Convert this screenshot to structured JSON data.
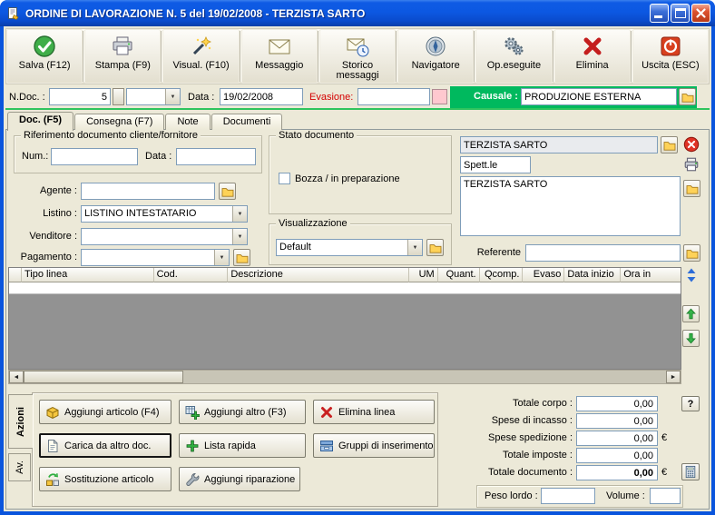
{
  "window": {
    "title": "ORDINE DI LAVORAZIONE N. 5  del 19/02/2008 - TERZISTA SARTO"
  },
  "colors": {
    "titlebar_blue": "#0a55dd",
    "causale_green": "#00b95e",
    "evasione_pink": "#ffc8cf",
    "grid_body_gray": "#929292"
  },
  "icons": {
    "combo_arrow": "▼",
    "scroll_left": "◄",
    "scroll_right": "►"
  },
  "toolbar": {
    "buttons": [
      {
        "label": "Salva (F12)",
        "icon": "save-check-icon"
      },
      {
        "label": "Stampa (F9)",
        "icon": "printer-icon"
      },
      {
        "label": "Visual. (F10)",
        "icon": "magic-wand-icon"
      },
      {
        "label": "Messaggio",
        "icon": "envelope-icon"
      },
      {
        "label": "Storico messaggi",
        "icon": "envelope-history-icon"
      },
      {
        "label": "Navigatore",
        "icon": "compass-icon"
      },
      {
        "label": "Op.eseguite",
        "icon": "gears-icon"
      },
      {
        "label": "Elimina",
        "icon": "red-x-icon"
      },
      {
        "label": "Uscita (ESC)",
        "icon": "power-icon"
      }
    ]
  },
  "doc_header": {
    "ndoc_label": "N.Doc. :",
    "ndoc_value": "5",
    "serie_value": "",
    "data_label": "Data :",
    "data_value": "19/02/2008",
    "evasione_label": "Evasione:",
    "evasione_value": "",
    "causale_label": "Causale :",
    "causale_value": "PRODUZIONE ESTERNA"
  },
  "tabs": [
    {
      "label": "Doc. (F5)",
      "active": true
    },
    {
      "label": "Consegna (F7)",
      "active": false
    },
    {
      "label": "Note",
      "active": false
    },
    {
      "label": "Documenti",
      "active": false
    }
  ],
  "form": {
    "riferimento_group_label": "Riferimento documento cliente/fornitore",
    "num_label": "Num.:",
    "num_value": "",
    "rif_data_label": "Data :",
    "rif_data_value": "",
    "agente_label": "Agente :",
    "agente_value": "",
    "listino_label": "Listino :",
    "listino_value": "LISTINO INTESTATARIO",
    "venditore_label": "Venditore :",
    "venditore_value": "",
    "pagamento_label": "Pagamento :",
    "pagamento_value": "",
    "stato_group_label": "Stato documento",
    "bozza_checkbox_label": "Bozza / in preparazione",
    "bozza_checked": false,
    "visualizzazione_group_label": "Visualizzazione",
    "visualizzazione_value": "Default",
    "intestatario_value": "TERZISTA SARTO",
    "titolo_value": "Spett.le",
    "indirizzo_value": "TERZISTA SARTO",
    "referente_label": "Referente",
    "referente_value": ""
  },
  "grid": {
    "columns": [
      "",
      "Tipo linea",
      "Cod.",
      "Descrizione",
      "UM",
      "Quant.",
      "Qcomp.",
      "Evaso",
      "Data inizio",
      "Ora in"
    ]
  },
  "actions": {
    "tab_azioni_label": "Azioni",
    "tab_av_label": "Av.",
    "buttons": [
      {
        "label": "Aggiungi articolo (F4)",
        "icon": "package-icon"
      },
      {
        "label": "Aggiungi altro (F3)",
        "icon": "add-grid-icon"
      },
      {
        "label": "Elimina linea",
        "icon": "delete-line-icon"
      },
      {
        "label": "Carica da altro doc.",
        "icon": "load-document-icon"
      },
      {
        "label": "Lista rapida",
        "icon": "add-plus-icon"
      },
      {
        "label": "Gruppi di inserimento",
        "icon": "insert-group-icon"
      },
      {
        "label": "Sostituzione articolo",
        "icon": "swap-article-icon"
      },
      {
        "label": "Aggiungi riparazione",
        "icon": "wrench-icon"
      }
    ]
  },
  "totals": {
    "rows": [
      {
        "label": "Totale corpo :",
        "value": "0,00",
        "suffix": ""
      },
      {
        "label": "Spese di incasso :",
        "value": "0,00",
        "suffix": ""
      },
      {
        "label": "Spese spedizione :",
        "value": "0,00",
        "suffix": "€"
      },
      {
        "label": "Totale imposte :",
        "value": "0,00",
        "suffix": ""
      },
      {
        "label": "Totale documento :",
        "value": "0,00",
        "suffix": "€"
      }
    ],
    "help_button_label": "?",
    "peso_lordo_label": "Peso lordo :",
    "peso_lordo_value": "",
    "volume_label": "Volume :",
    "volume_value": ""
  }
}
